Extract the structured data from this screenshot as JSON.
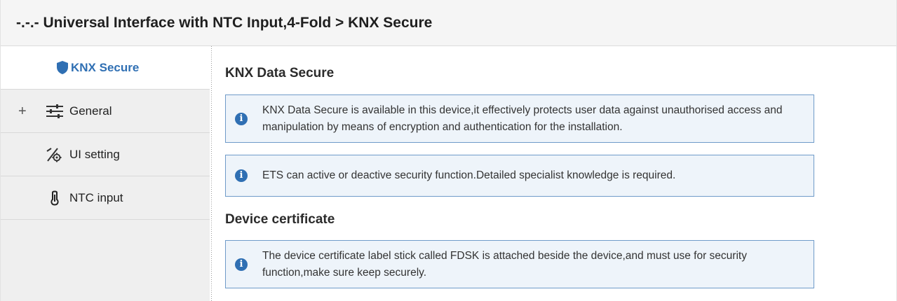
{
  "window": {
    "title": "-.-.- Universal Interface with NTC Input,4-Fold > KNX Secure"
  },
  "sidebar": {
    "items": [
      {
        "label": "KNX Secure",
        "icon": "shield-icon",
        "active": true,
        "expandable": false
      },
      {
        "label": "General",
        "icon": "sliders-icon",
        "active": false,
        "expandable": true,
        "expander": "+"
      },
      {
        "label": "UI setting",
        "icon": "ui-setting-icon",
        "active": false,
        "expandable": false
      },
      {
        "label": "NTC input",
        "icon": "thermometer-icon",
        "active": false,
        "expandable": false
      }
    ]
  },
  "main": {
    "sections": [
      {
        "title": "KNX Data Secure",
        "notes": [
          "KNX Data Secure is available in this device,it effectively protects user data against unauthorised access and manipulation by means of encryption and authentication for the installation.",
          "ETS can active or deactive security function.Detailed specialist knowledge is required."
        ]
      },
      {
        "title": "Device certificate",
        "notes": [
          "The device certificate label stick called FDSK is attached beside the device,and must use for security function,make sure keep securely."
        ]
      }
    ]
  },
  "colors": {
    "accent": "#2f6fb3",
    "info_box_bg": "#eef4fa",
    "info_box_border": "#6f9bc9",
    "sidebar_bg": "#efefef"
  }
}
